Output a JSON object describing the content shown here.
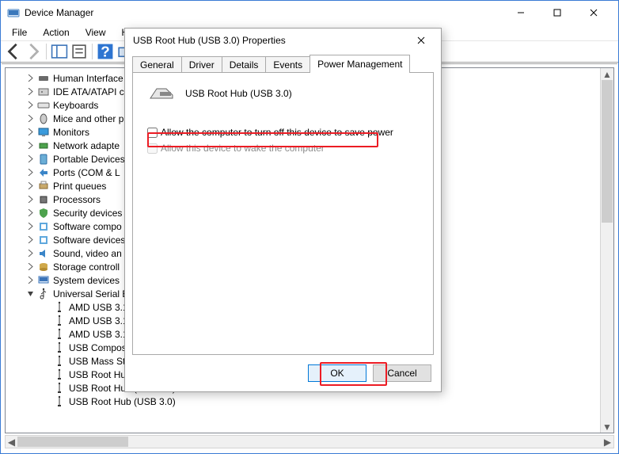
{
  "window": {
    "title": "Device Manager",
    "menu": {
      "file": "File",
      "action": "Action",
      "view": "View",
      "help": "Help"
    }
  },
  "tree": {
    "items": [
      "Human Interface",
      "IDE ATA/ATAPI c",
      "Keyboards",
      "Mice and other p",
      "Monitors",
      "Network adapte",
      "Portable Devices",
      "Ports (COM & L",
      "Print queues",
      "Processors",
      "Security devices",
      "Software compo",
      "Software devices",
      "Sound, video an",
      "Storage controll",
      "System devices"
    ],
    "usb_category": "Universal Serial B",
    "usb_children": [
      "AMD USB 3.1",
      "AMD USB 3.1",
      "AMD USB 3.1",
      "USB Compos",
      "USB Mass St",
      "USB Root Hu",
      "USB Root Hub (USB 3.0)",
      "USB Root Hub (USB 3.0)"
    ]
  },
  "dialog": {
    "title": "USB Root Hub (USB 3.0) Properties",
    "tabs": {
      "general": "General",
      "driver": "Driver",
      "details": "Details",
      "events": "Events",
      "power": "Power Management"
    },
    "device_name": "USB Root Hub (USB 3.0)",
    "opt_turnoff": "Allow the computer to turn off this device to save power",
    "opt_wake": "Allow this device to wake the computer",
    "ok": "OK",
    "cancel": "Cancel"
  }
}
